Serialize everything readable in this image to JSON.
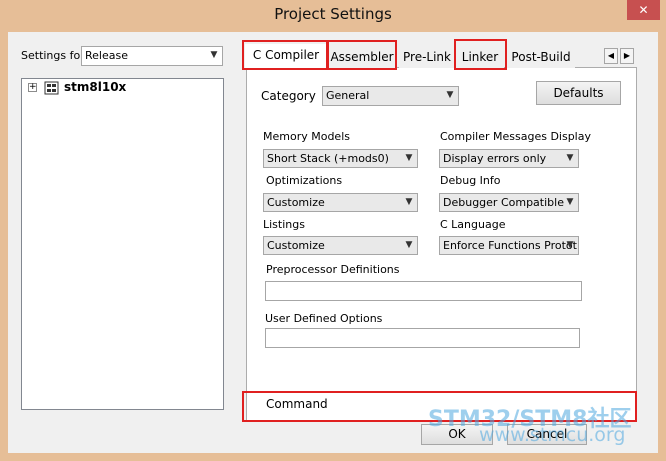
{
  "window": {
    "title": "Project Settings",
    "close_glyph": "✕"
  },
  "left": {
    "settings_for_label": "Settings for:",
    "settings_for_value": "Release",
    "tree_expander": "⊞",
    "tree_item": "stm8l10x"
  },
  "tabs": [
    "C Compiler",
    "Assembler",
    "Pre-Link",
    "Linker",
    "Post-Build"
  ],
  "tab_scroll": {
    "left": "◀",
    "right": "▶"
  },
  "panel": {
    "category_label": "Category",
    "category_value": "General",
    "defaults_button": "Defaults",
    "memory_models_label": "Memory Models",
    "memory_models_value": "Short Stack (+mods0)",
    "compiler_messages_label": "Compiler Messages Display",
    "compiler_messages_value": "Display errors only",
    "optimizations_label": "Optimizations",
    "optimizations_value": "Customize",
    "debug_info_label": "Debug Info",
    "debug_info_value": "Debugger Compatible",
    "listings_label": "Listings",
    "listings_value": "Customize",
    "c_language_label": "C Language",
    "c_language_value": "Enforce Functions Protot",
    "preprocessor_label": "Preprocessor Definitions",
    "preprocessor_value": "",
    "user_defined_label": "User Defined Options",
    "user_defined_value": "",
    "command_label": "Command"
  },
  "footer": {
    "ok_button": "OK",
    "cancel_button": "Cancel"
  },
  "watermark": {
    "line1": "STM32/STM8社区",
    "line2": "www.stmcu.org"
  },
  "colors": {
    "title_bar": "#e6be97",
    "close_button": "#c75050",
    "highlight": "#e02020",
    "watermark": "#4fa8e0"
  },
  "icons": {
    "dropdown": "chevron-down-icon",
    "tree_expand": "plus-box-icon",
    "project": "project-icon"
  }
}
